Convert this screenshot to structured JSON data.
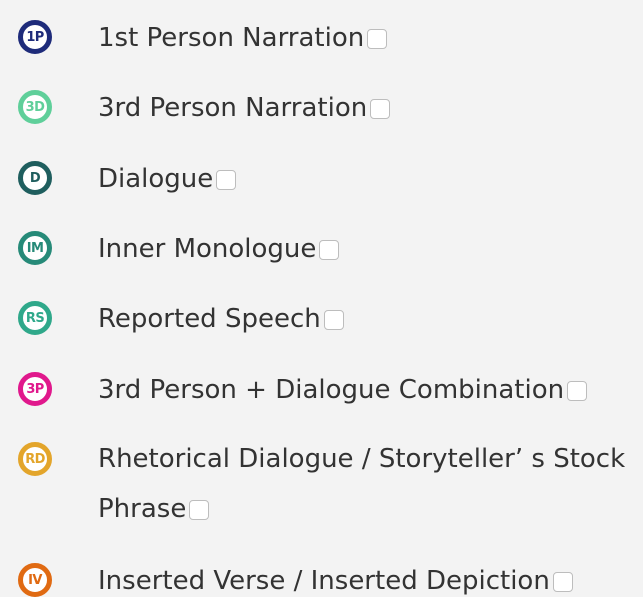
{
  "legend": {
    "items": [
      {
        "badge": "1P",
        "label": "1st Person Narration",
        "color": "#1e2b7a",
        "checked": false
      },
      {
        "badge": "3D",
        "label": "3rd Person Narration",
        "color": "#5fcf9a",
        "checked": false
      },
      {
        "badge": "D",
        "label": "Dialogue",
        "color": "#1f5e5e",
        "checked": false
      },
      {
        "badge": "IM",
        "label": "Inner Monologue",
        "color": "#268a78",
        "checked": false
      },
      {
        "badge": "RS",
        "label": "Reported Speech",
        "color": "#2fa88a",
        "checked": false
      },
      {
        "badge": "3P",
        "label": "3rd Person + Dialogue Combination",
        "color": "#e0188c",
        "checked": false
      },
      {
        "badge": "RD",
        "label": "Rhetorical Dialogue / Storyteller’ s Stock Phrase",
        "color": "#e3a52b",
        "checked": false
      },
      {
        "badge": "IV",
        "label": "Inserted Verse / Inserted Depiction",
        "color": "#e06a12",
        "checked": false
      }
    ]
  }
}
